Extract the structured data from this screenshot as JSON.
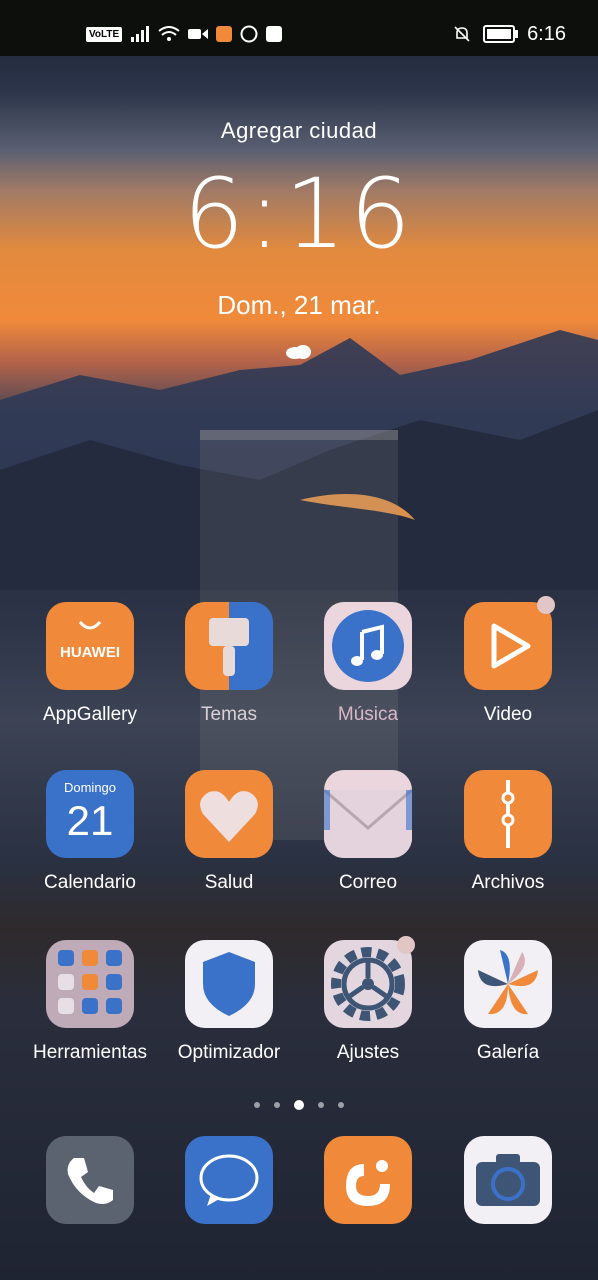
{
  "status_bar": {
    "volte": "VoLTE",
    "time": "6:16"
  },
  "lockclock": {
    "city": "Agregar ciudad",
    "time": "6:16",
    "date": "Dom., 21 mar."
  },
  "apps": [
    {
      "label": "AppGallery",
      "brand": "HUAWEI"
    },
    {
      "label": "Temas"
    },
    {
      "label": "Música"
    },
    {
      "label": "Video"
    },
    {
      "label": "Calendario",
      "weekday": "Domingo",
      "day": "21"
    },
    {
      "label": "Salud"
    },
    {
      "label": "Correo"
    },
    {
      "label": "Archivos"
    },
    {
      "label": "Herramientas"
    },
    {
      "label": "Optimizador"
    },
    {
      "label": "Ajustes"
    },
    {
      "label": "Galería"
    }
  ],
  "dock": [
    {
      "icon": "phone-icon"
    },
    {
      "icon": "messages-icon"
    },
    {
      "icon": "uc-browser-icon"
    },
    {
      "icon": "camera-icon"
    }
  ],
  "colors": {
    "orange": "#f08a3a",
    "blue": "#3b72c9",
    "white_icon": "#f2f0f5"
  }
}
